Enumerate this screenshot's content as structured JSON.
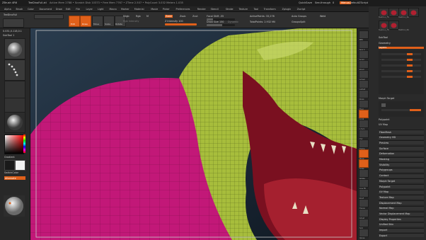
{
  "titlebar": {
    "app_name": "ZBrush 4R6",
    "document": "TeeDinoFull.ztl",
    "stats": "Active Mem 2788 • Scratch Disk 10373 • Free Mem 7767 • ZTime 2.507 • PolyCount 3.032 Meters 1.035",
    "quicksave": "QuickSave",
    "see_through": "See-through",
    "see_through_val": "0",
    "menus_btn": "Menus",
    "default_script": "DefaultZScript"
  },
  "menubar": [
    "Alpha",
    "Brush",
    "Color",
    "Document",
    "Draw",
    "Edit",
    "File",
    "Layer",
    "Light",
    "Macro",
    "Marker",
    "Material",
    "Movie",
    "Picker",
    "Preferences",
    "Render",
    "Stencil",
    "Stroke",
    "Texture",
    "Tool",
    "Transform",
    "Zplugin",
    "Zscript"
  ],
  "toolbar": {
    "tool_name": "TeeDinoFull",
    "edit": "Edit",
    "draw": "Draw",
    "move": "Move",
    "scale": "Scale",
    "rotate": "Rotate",
    "mrgb": "Mrgb",
    "rgb": "Rgb",
    "m": "M",
    "zadd": "Zadd",
    "zsub": "Zsub",
    "zcut": "Zcut",
    "rgb_intensity": "Rgb Intensity",
    "z_intensity": "Z Intensity 100",
    "focal_shift": "Focal Shift -55",
    "draw_size": "Draw Size 150",
    "dynamic": "Dynamic",
    "active_points": "ActivePoints: 33,278",
    "total_points": "TotalPoints: 2.932 Mil",
    "auto_groups": "Auto Groups",
    "groups_split": "GroupsSplit",
    "weld": "Weld"
  },
  "lefttray": {
    "tool_info": "0.031,0.118,0.1",
    "subtool_label": "SubTool 1",
    "gradient": "Gradient",
    "switch_color": "SwitchColor",
    "alternate": "Alternate"
  },
  "right_icons": [
    "BPR",
    "Spix 3",
    "Scroll",
    "Zoom",
    "Actual",
    "AAHalf",
    "Persp",
    "Floor",
    "Local",
    "L.Sym",
    "Xyz",
    "Frame",
    "Move",
    "Scale",
    "Rotate",
    "Line Fill",
    "PolyF",
    "Transp",
    "Ghost",
    "Solo",
    "Xpose"
  ],
  "subtools": [
    "TeeDino_FR",
    "TeeDino_RA",
    "TeeDino_FR",
    "TeeDino_RA",
    "TeeDino_FR",
    "TeeDino_RA"
  ],
  "right_panel": {
    "subtool": "SubTool",
    "geometry": "Geometry",
    "layers_label": "Layers",
    "morph_target": "Morph Target",
    "polypaint": "Polypaint",
    "uv_map": "UV Map",
    "sections": [
      "FiberMesh",
      "Geometry HD",
      "Preview",
      "Surface",
      "Deformation",
      "Masking",
      "Visibility",
      "Polygroups",
      "Contact",
      "Morph Target",
      "Polypaint",
      "UV Map",
      "Texture Map",
      "Displacement Map",
      "Normal Map",
      "Vector Displacement Map",
      "Display Properties",
      "Unified Skin",
      "Import",
      "Export"
    ]
  },
  "colors": {
    "accent": "#e0601a",
    "viewport_bg": "#203040",
    "dino_skin": "#a7bd3c",
    "shirt": "#c21878",
    "mouth": "#7a1020"
  }
}
